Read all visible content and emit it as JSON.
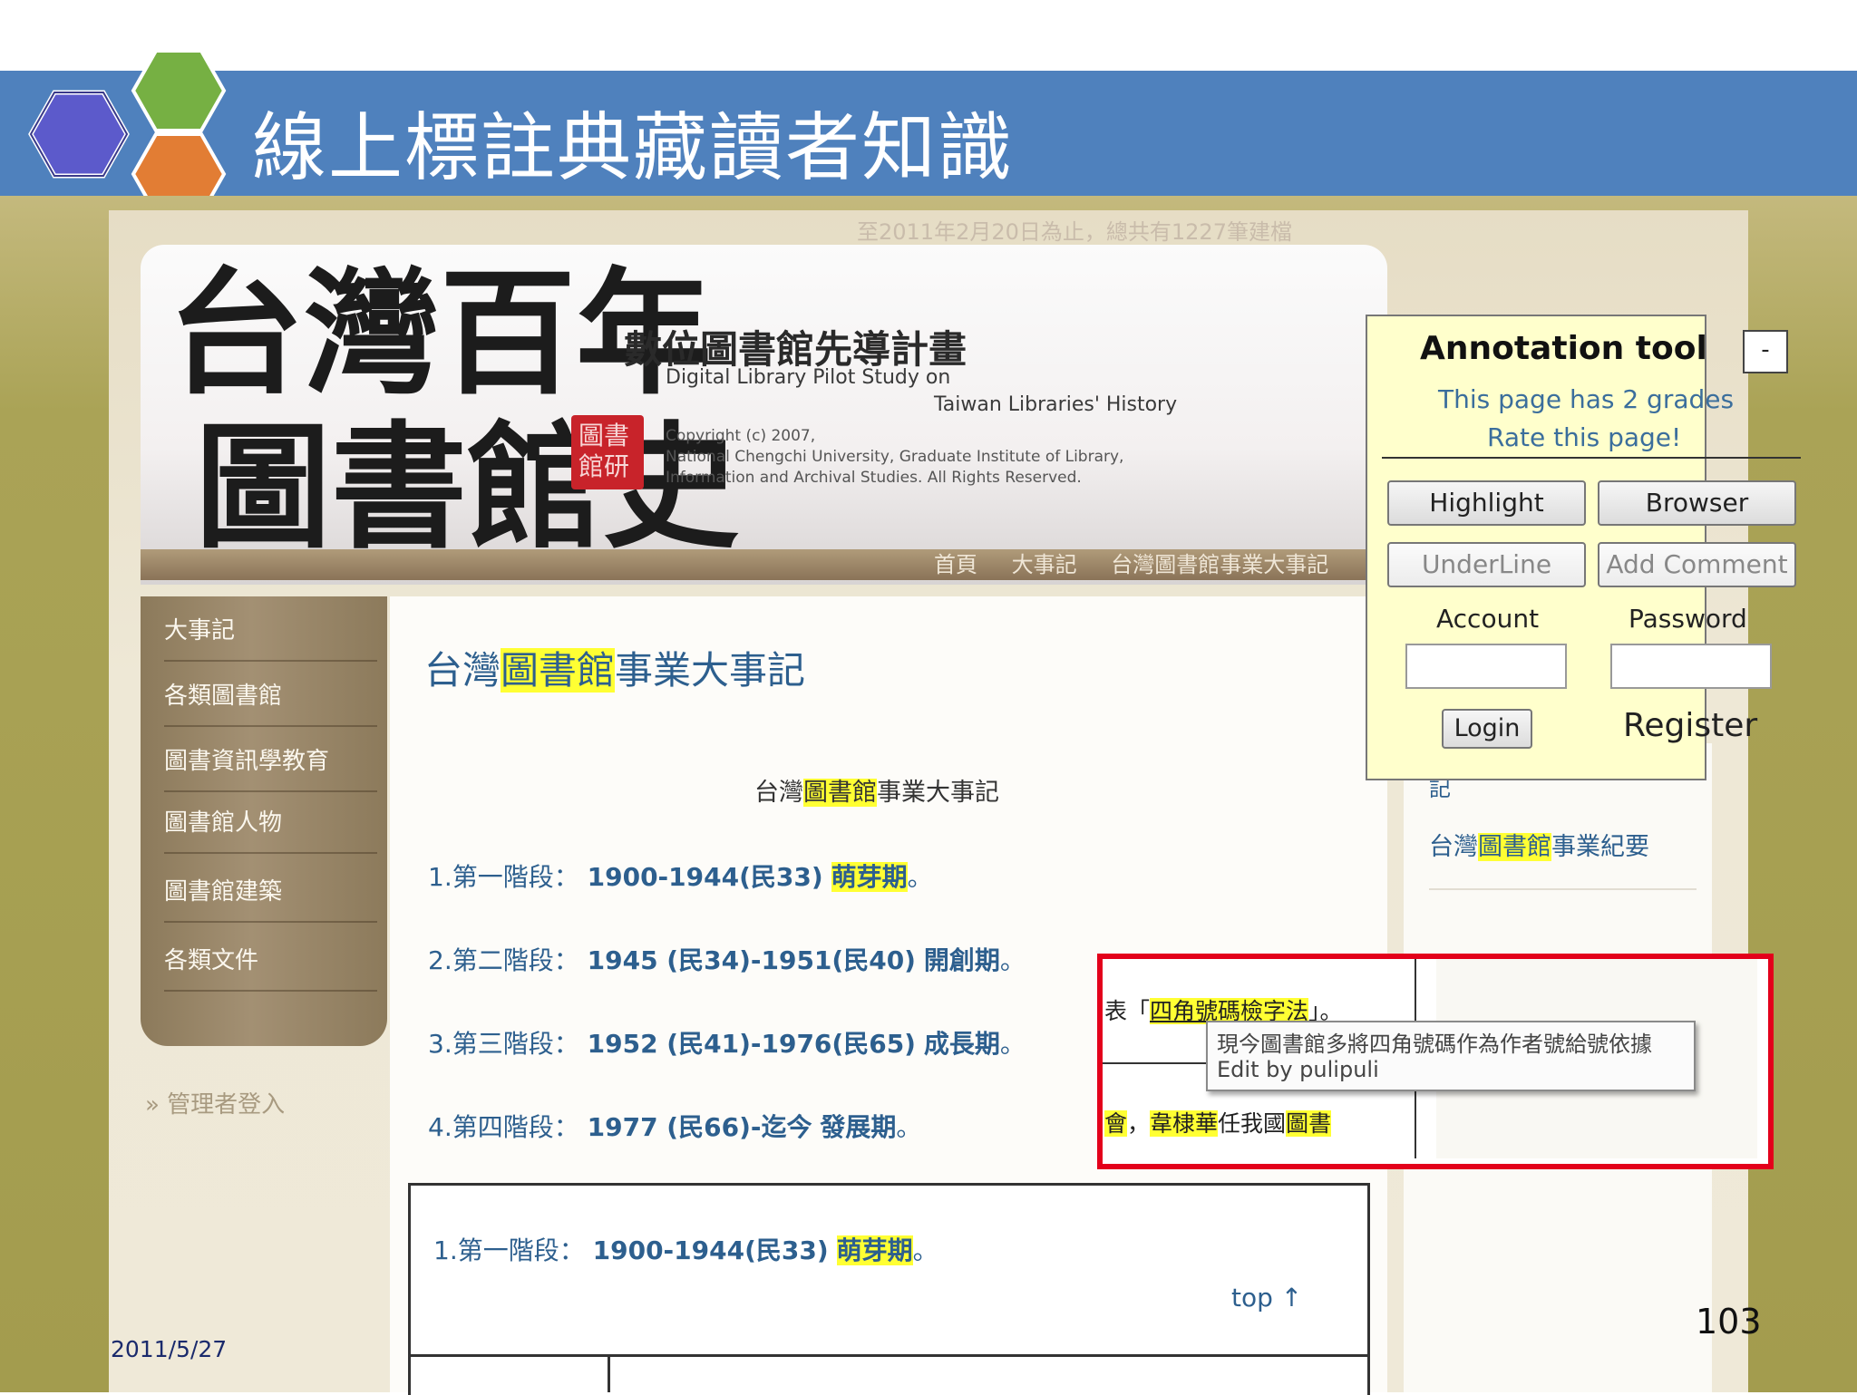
{
  "slide": {
    "title": "線上標註典藏讀者知識",
    "date": "2011/5/27",
    "page_number": "103"
  },
  "site": {
    "stats_text": "至2011年2月20日為止，總共有1227筆建檔",
    "logo_calligraphy": "台灣百年圖書館史",
    "seal_text": "圖書 館研",
    "title_zh": "數位圖書館先導計畫",
    "title_en_line1": "Digital Library Pilot Study on",
    "title_en_line2": "Taiwan Libraries' History",
    "copyright_lines": [
      "Copyright (c) 2007,",
      "National Chengchi University, Graduate Institute of Library,",
      "Information and Archival Studies. All Rights Reserved."
    ],
    "nav": [
      {
        "label": "首頁"
      },
      {
        "label": "大事記"
      },
      {
        "label": "台灣圖書館事業大事記"
      }
    ],
    "left_menu": [
      {
        "label": "大事記"
      },
      {
        "label": "各類圖書館"
      },
      {
        "label": "圖書資訊學教育"
      },
      {
        "label": "圖書館人物"
      },
      {
        "label": "圖書館建築"
      },
      {
        "label": "各類文件"
      }
    ],
    "admin_login": "» 管理者登入"
  },
  "content": {
    "heading_pre": "台灣",
    "heading_hl": "圖書館",
    "heading_post": "事業大事記",
    "center_pre": "台灣",
    "center_hl": "圖書館",
    "center_post": "事業大事記",
    "stages": [
      {
        "prefix": "1.第一階段：",
        "range": "1900-1944(民33)",
        "name": "萌芽期",
        "highlight": true,
        "end": "。"
      },
      {
        "prefix": "2.第二階段：",
        "range": "1945 (民34)-1951(民40)",
        "name": "開創期",
        "highlight": false,
        "end": "。"
      },
      {
        "prefix": "3.第三階段：",
        "range": "1952 (民41)-1976(民65)",
        "name": "成長期",
        "highlight": false,
        "end": "。"
      },
      {
        "prefix": "4.第四階段：",
        "range": "1977 (民66)-迄今",
        "name": "發展期",
        "highlight": false,
        "end": "。"
      }
    ],
    "box_stage": {
      "prefix": "1.第一階段：",
      "range": "1900-1944(民33)",
      "name": "萌芽期",
      "end": "。"
    },
    "top_link": "top ↑",
    "right_link1": "記",
    "right_link2_pre": "台灣",
    "right_link2_hl": "圖書館",
    "right_link2_post": "事業紀要"
  },
  "annotation_tool": {
    "title": "Annotation tool",
    "minimize": "-",
    "grades_text": "This page has 2 grades",
    "rate_text": "Rate this page!",
    "buttons": {
      "highlight": "Highlight",
      "browser": "Browser",
      "underline": "UnderLine",
      "add_comment": "Add Comment"
    },
    "account_label": "Account",
    "password_label": "Password",
    "account_value": "",
    "password_value": "",
    "login": "Login",
    "register": "Register"
  },
  "callout": {
    "line1_pre": "表「",
    "line1_hl": "四角號碼檢字法",
    "line1_post": "」。",
    "line2_a": "會",
    "line2_b": "，",
    "line2_hl1": "韋棣華",
    "line2_c": "任我國",
    "line2_hl2": "圖書",
    "tooltip_line1": "現今圖書館多將四角號碼作為作者號給號依據",
    "tooltip_line2": "Edit by pulipuli"
  },
  "colors": {
    "title_band": "#4f81bd",
    "highlight": "#ffff33",
    "link": "#2d5f8e",
    "callout_border": "#e3001b",
    "annotation_bg": "#ffffcc"
  }
}
